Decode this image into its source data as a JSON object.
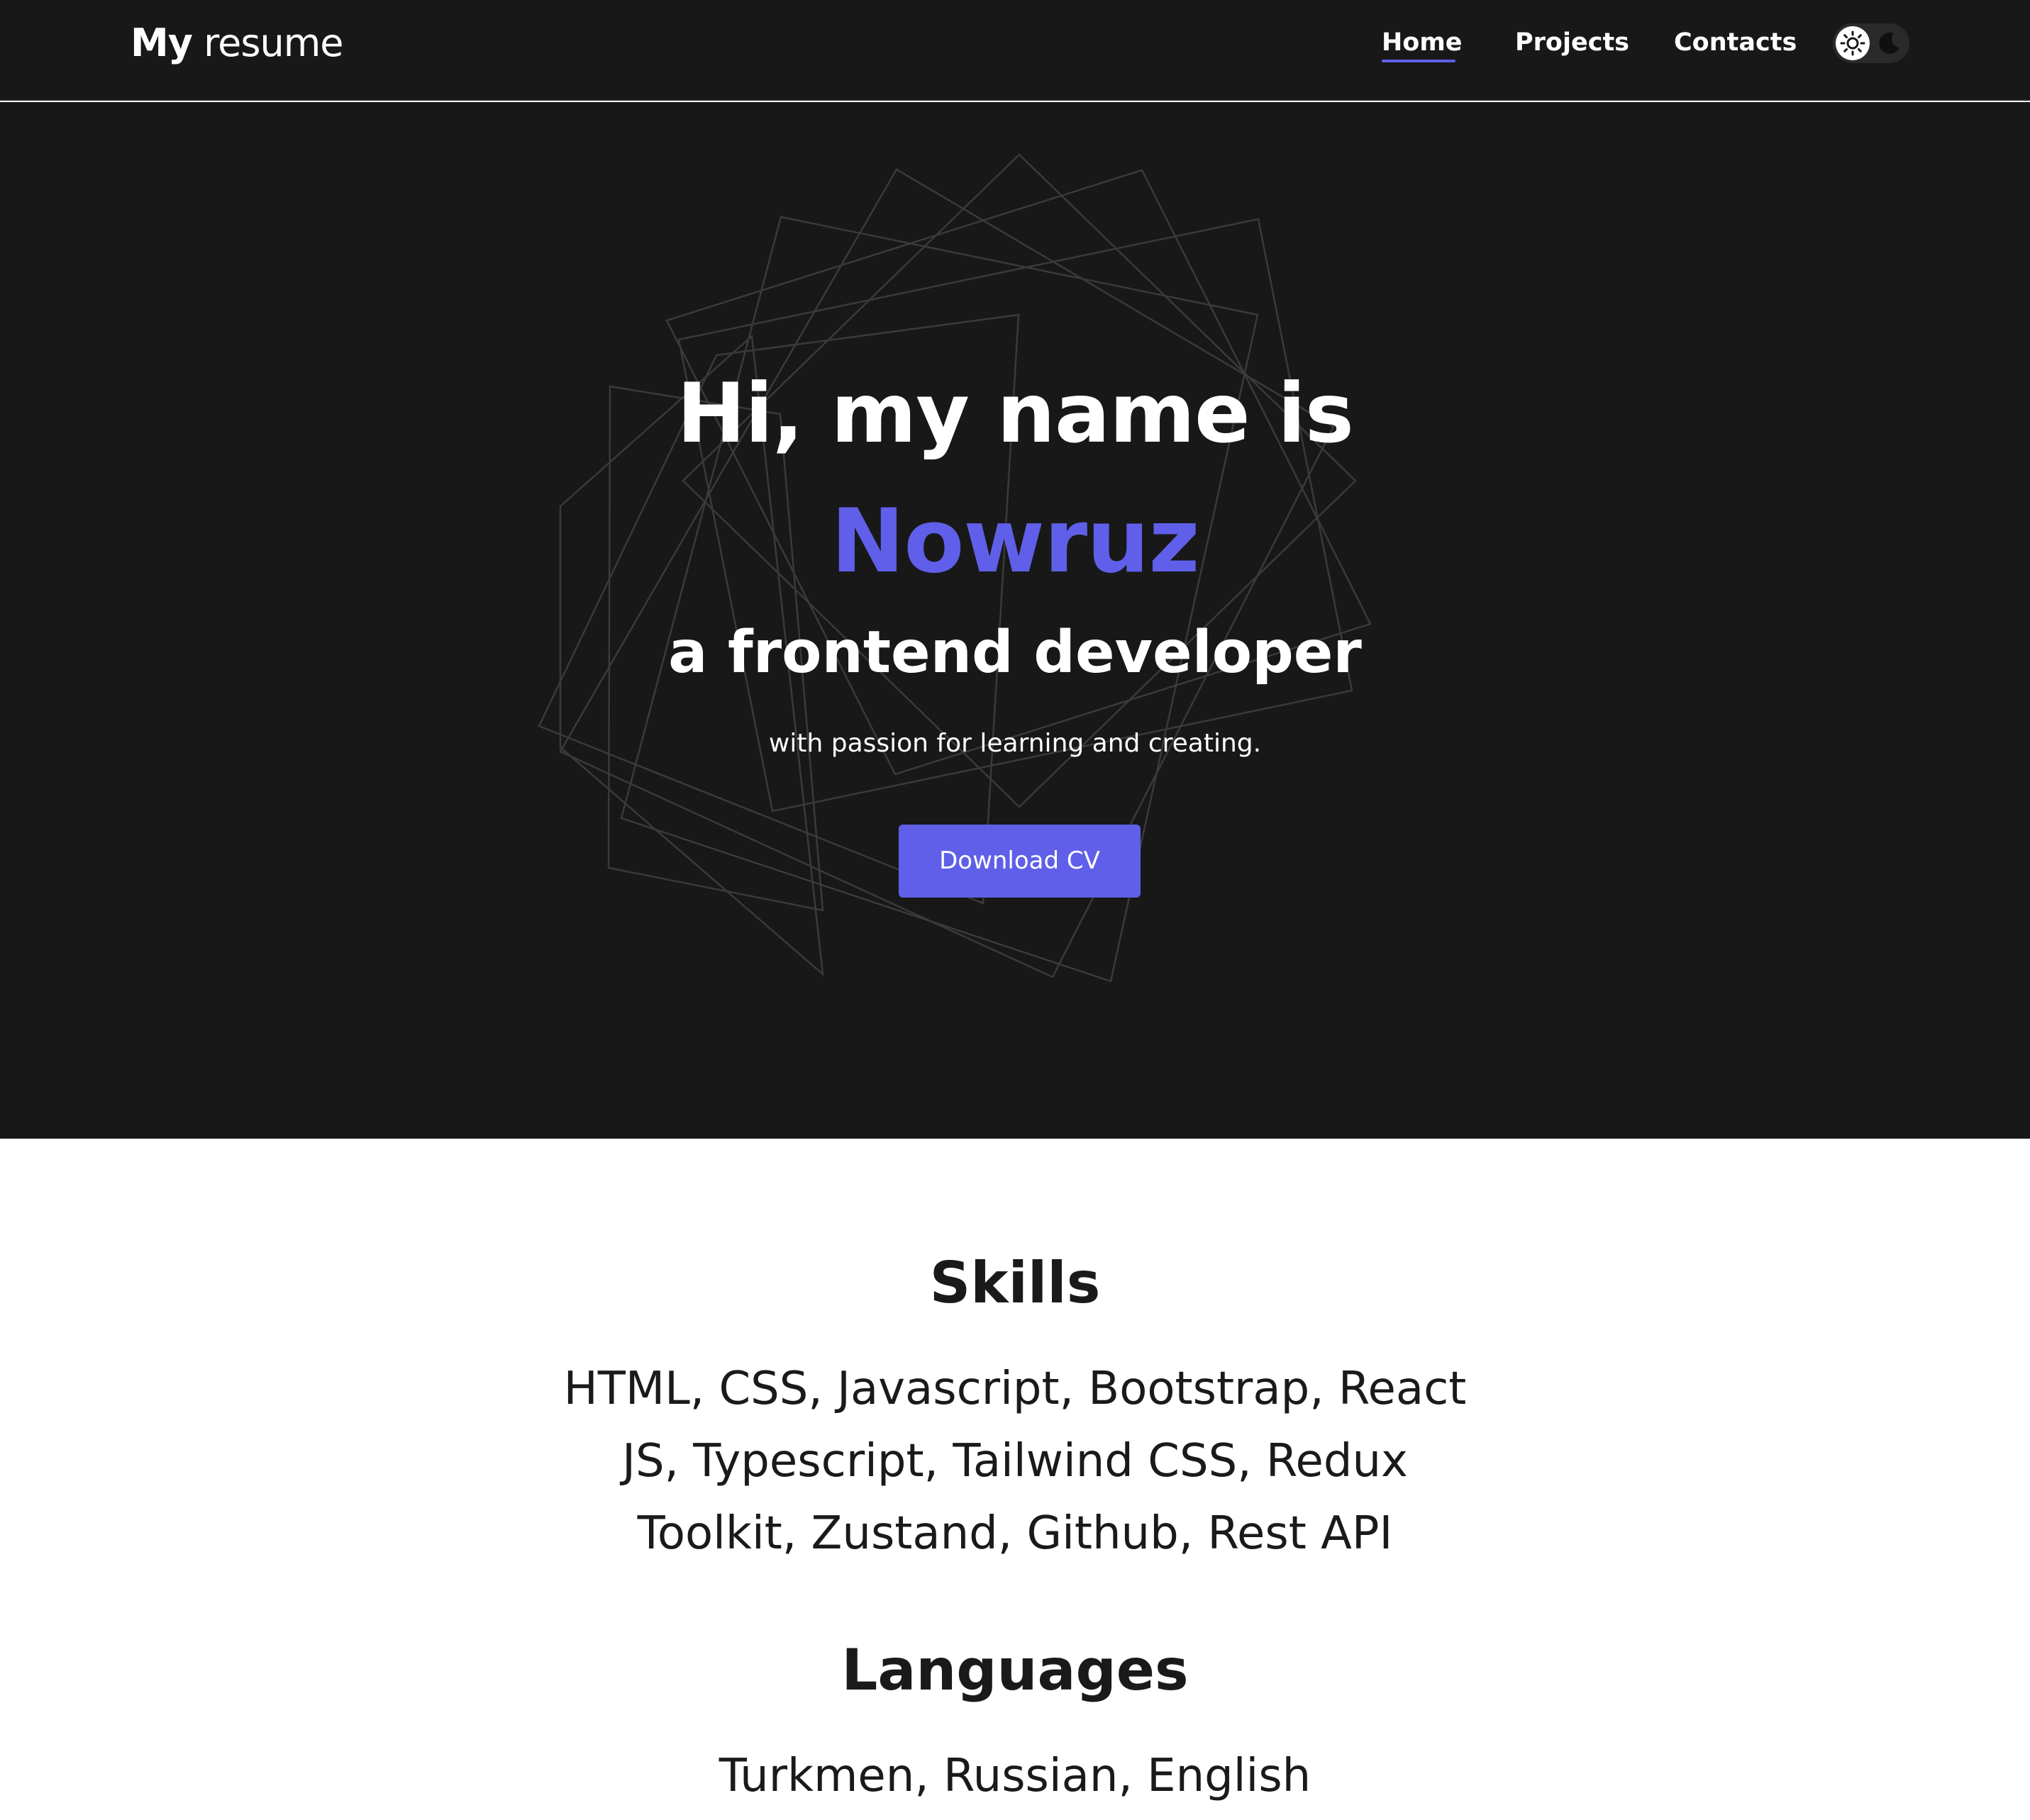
{
  "nav": {
    "logo_bold": "My",
    "logo_light": "resume",
    "links": [
      {
        "label": "Home",
        "active": true
      },
      {
        "label": "Projects",
        "active": false
      },
      {
        "label": "Contacts",
        "active": false
      }
    ],
    "theme_icons": [
      "sun-icon",
      "moon-icon"
    ]
  },
  "hero": {
    "greeting": "Hi, my name is",
    "name": "Nowruz",
    "role": "a frontend developer",
    "tagline": "with passion for learning and creating.",
    "cta_label": "Download CV"
  },
  "skills": {
    "title": "Skills",
    "lines": [
      "HTML, CSS, Javascript, Bootstrap, React",
      "JS, Typescript, Tailwind CSS, Redux",
      "Toolkit, Zustand, Github, Rest API"
    ]
  },
  "languages": {
    "title": "Languages",
    "text": "Turkmen, Russian, English"
  },
  "colors": {
    "background_dark": "#181818",
    "accent": "#5f5fe9",
    "text_light": "#ffffff",
    "text_dark": "#1a1a1a"
  }
}
